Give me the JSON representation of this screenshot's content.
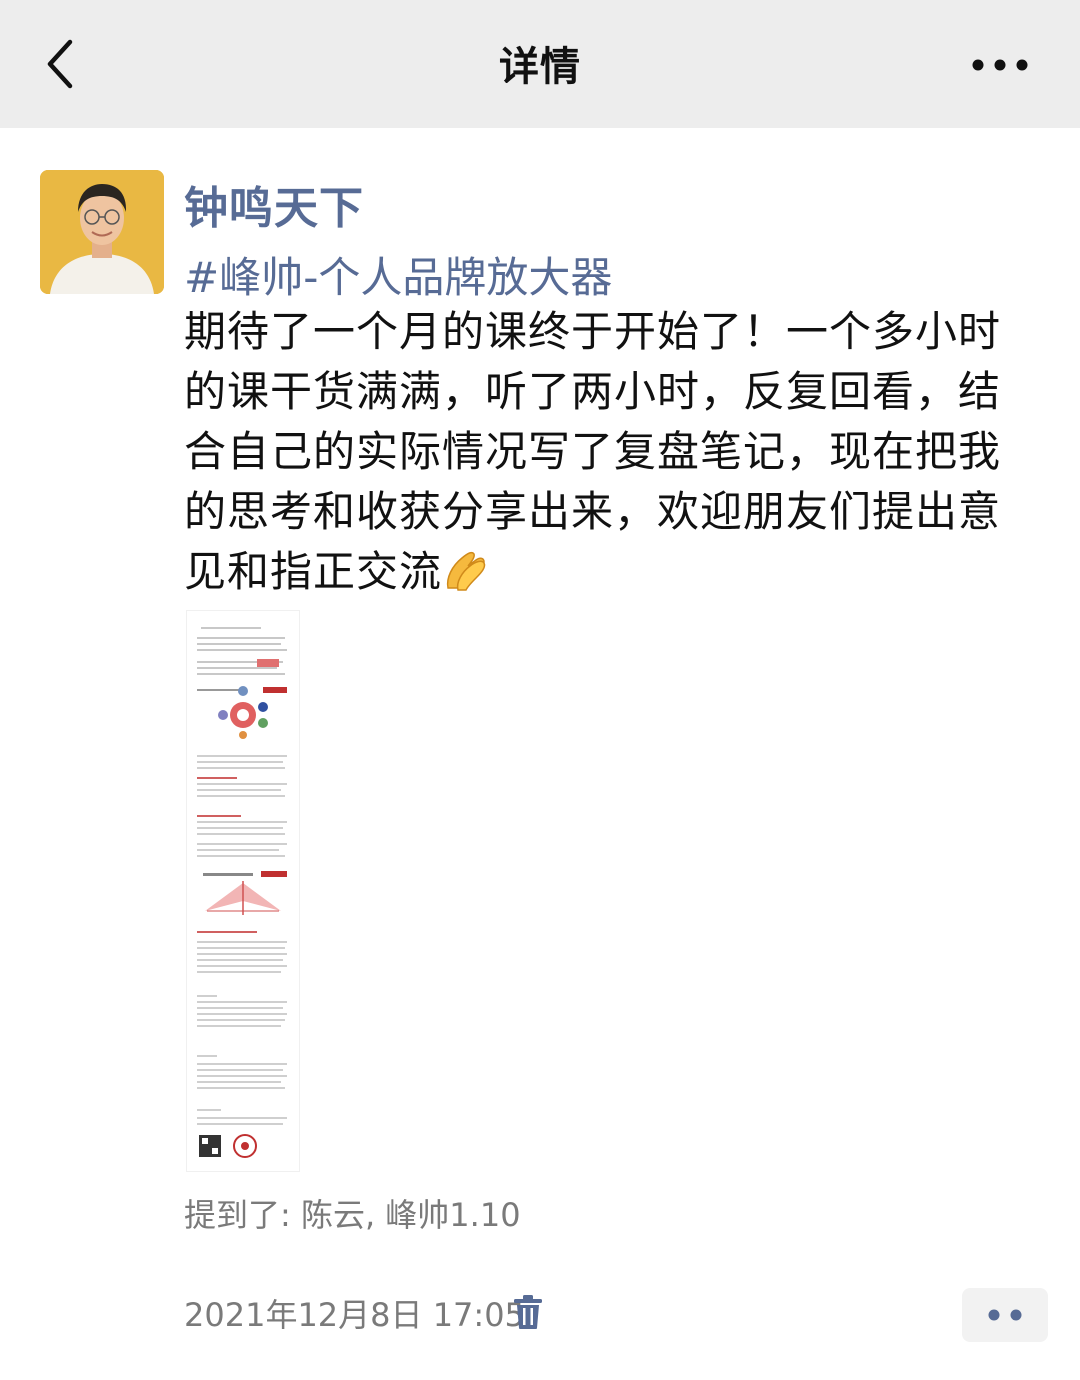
{
  "header": {
    "title": "详情",
    "back_icon": "chevron-left-icon",
    "more_icon": "more-dots-icon"
  },
  "post": {
    "author": "钟鸣天下",
    "hashtag": "#峰帅-个人品牌放大器",
    "text": "期待了一个月的课终于开始了！一个多小时的课干货满满，听了两小时，反复回看，结合自己的实际情况写了复盘笔记，现在把我的思考和收获分享出来，欢迎朋友们提出意见和指正交流",
    "text_emoji_icon": "pray-hands-icon",
    "mentions": "提到了:  陈云, 峰帅1.10",
    "timestamp": "2021年12月8日 17:05",
    "delete_icon": "trash-icon",
    "action_icon": "two-dots-icon"
  },
  "colors": {
    "topbar_bg": "#ededed",
    "link_blue": "#576b95",
    "meta_gray": "#7a7a7a"
  }
}
